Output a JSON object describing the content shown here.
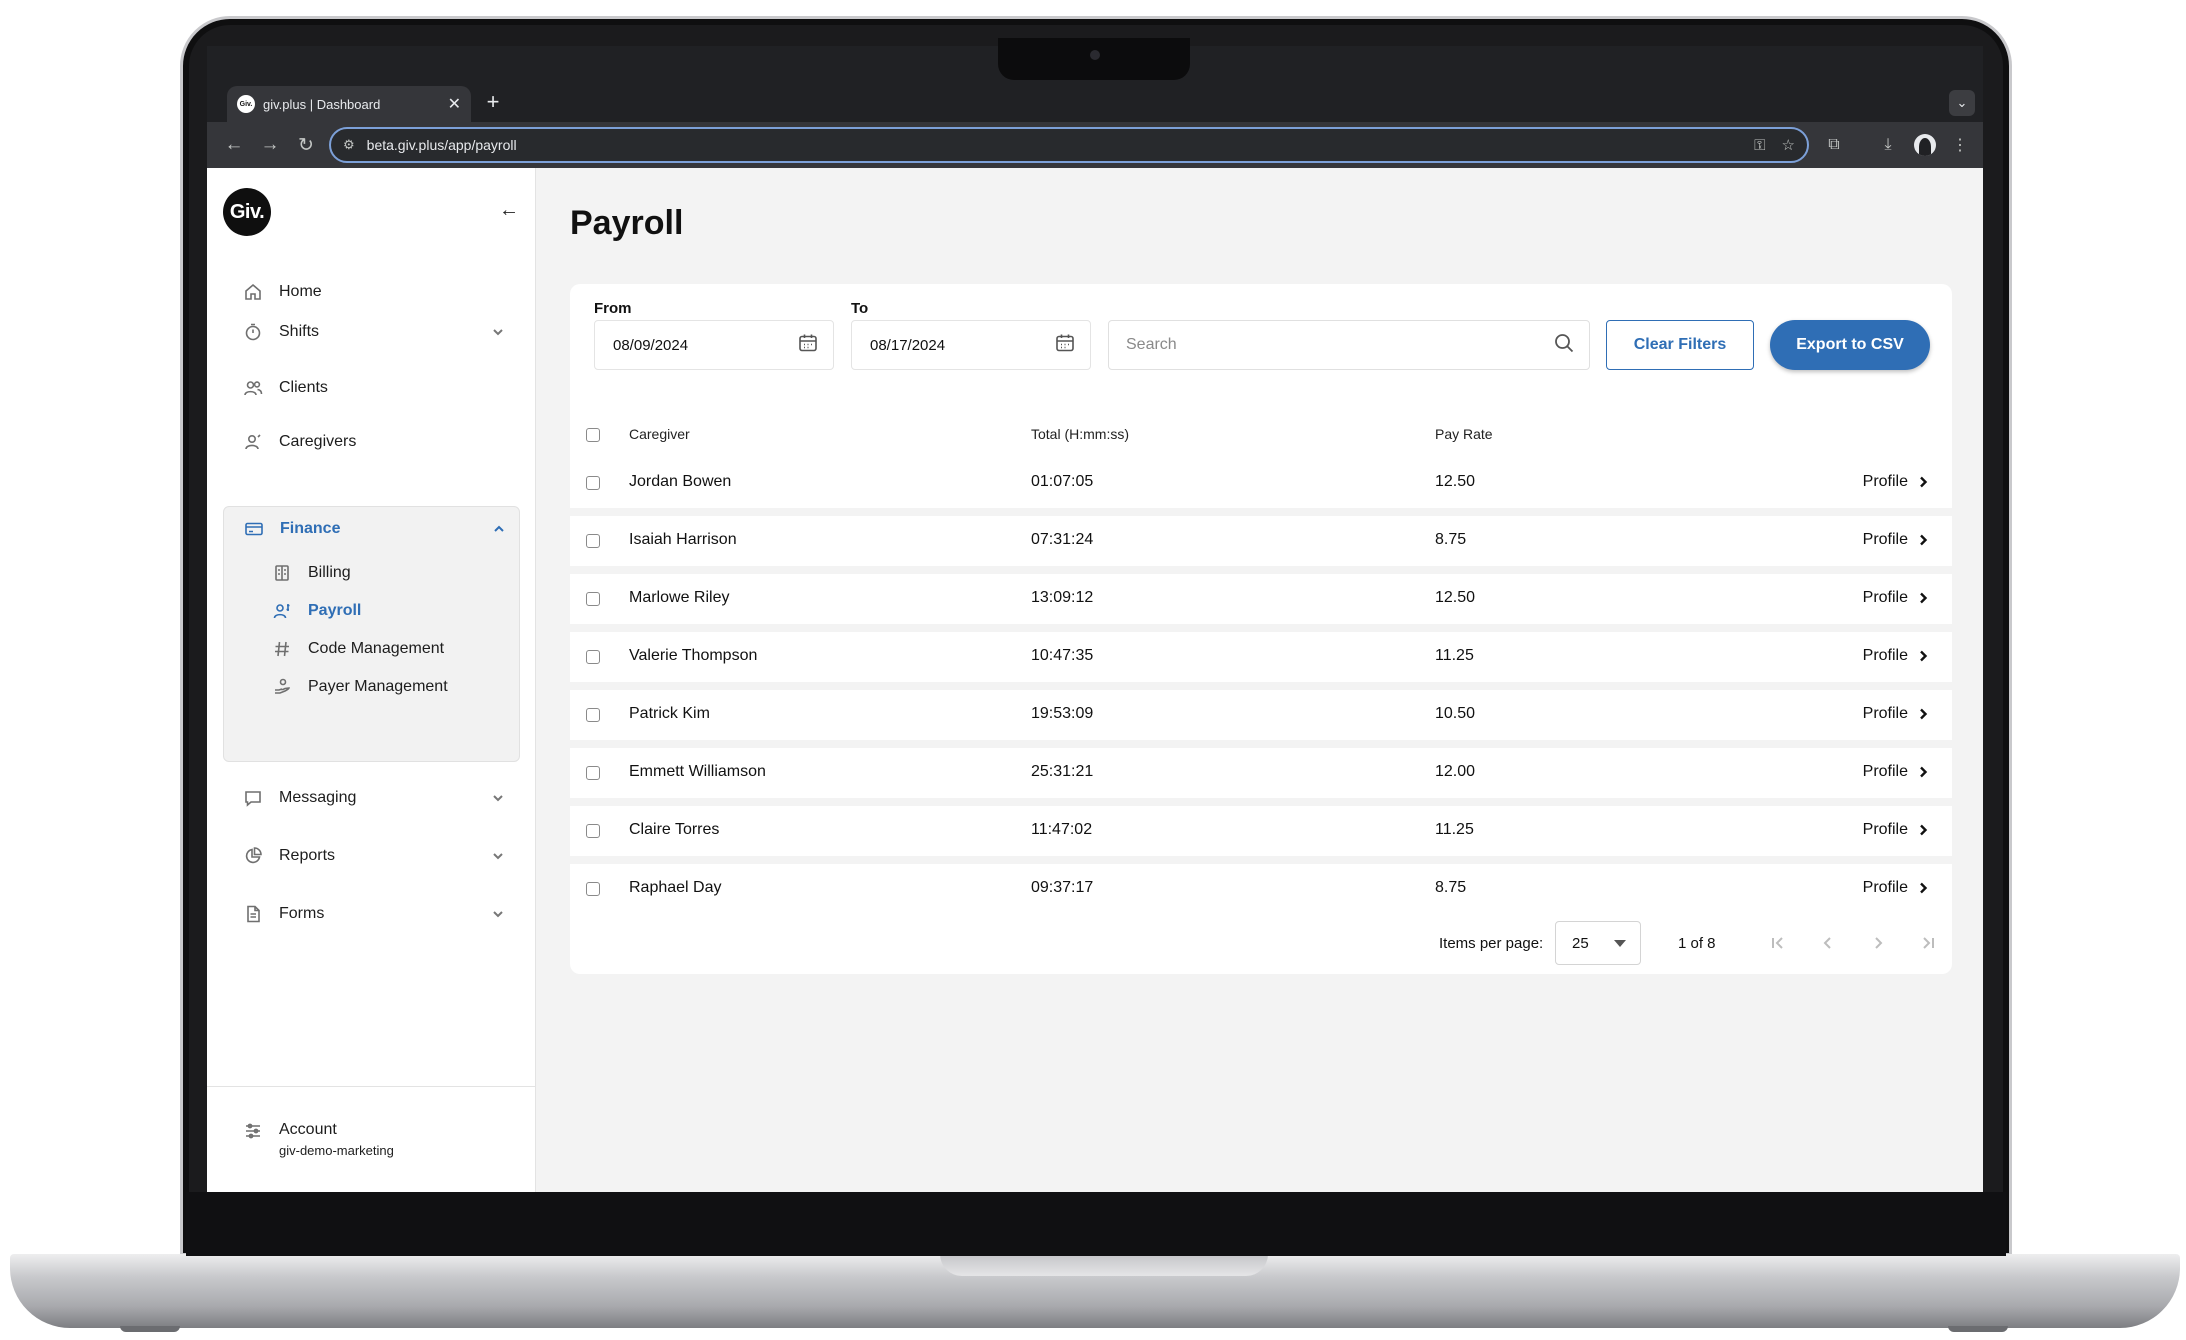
{
  "browser": {
    "tab_title": "giv.plus | Dashboard",
    "favicon_text": "Giv.",
    "url": "beta.giv.plus/app/payroll"
  },
  "sidebar": {
    "logo_text": "Giv.",
    "items": [
      {
        "label": "Home",
        "icon": "home-icon"
      },
      {
        "label": "Shifts",
        "icon": "stopwatch-icon"
      },
      {
        "label": "Clients",
        "icon": "users-icon"
      },
      {
        "label": "Caregivers",
        "icon": "user-icon"
      }
    ],
    "finance": {
      "label": "Finance",
      "icon": "credit-card-icon",
      "subitems": [
        {
          "label": "Billing",
          "icon": "ledger-icon"
        },
        {
          "label": "Payroll",
          "icon": "person-dollar-icon"
        },
        {
          "label": "Code Management",
          "icon": "hash-icon"
        },
        {
          "label": "Payer Management",
          "icon": "payer-hand-icon"
        }
      ]
    },
    "bottom_items": [
      {
        "label": "Messaging",
        "icon": "chat-icon"
      },
      {
        "label": "Reports",
        "icon": "pie-chart-icon"
      },
      {
        "label": "Forms",
        "icon": "document-icon"
      }
    ],
    "account": {
      "label": "Account",
      "org": "giv-demo-marketing"
    }
  },
  "main": {
    "title": "Payroll",
    "filters": {
      "from_label": "From",
      "from_value": "08/09/2024",
      "to_label": "To",
      "to_value": "08/17/2024",
      "search_placeholder": "Search",
      "clear_label": "Clear Filters",
      "export_label": "Export to CSV"
    },
    "table": {
      "columns": [
        "Caregiver",
        "Total (H:mm:ss)",
        "Pay Rate"
      ],
      "link_label": "Profile",
      "rows": [
        {
          "caregiver": "Jordan Bowen",
          "total": "01:07:05",
          "rate": "12.50"
        },
        {
          "caregiver": "Isaiah Harrison",
          "total": "07:31:24",
          "rate": "8.75"
        },
        {
          "caregiver": "Marlowe Riley",
          "total": "13:09:12",
          "rate": "12.50"
        },
        {
          "caregiver": "Valerie Thompson",
          "total": "10:47:35",
          "rate": "11.25"
        },
        {
          "caregiver": "Patrick Kim",
          "total": "19:53:09",
          "rate": "10.50"
        },
        {
          "caregiver": "Emmett Williamson",
          "total": "25:31:21",
          "rate": "12.00"
        },
        {
          "caregiver": "Claire Torres",
          "total": "11:47:02",
          "rate": "11.25"
        },
        {
          "caregiver": "Raphael Day",
          "total": "09:37:17",
          "rate": "8.75"
        }
      ]
    },
    "pagination": {
      "items_per_page_label": "Items per page:",
      "items_per_page": "25",
      "page_info": "1 of 8"
    }
  },
  "colors": {
    "accent": "#2f6eb5",
    "background": "#f3f3f3"
  }
}
